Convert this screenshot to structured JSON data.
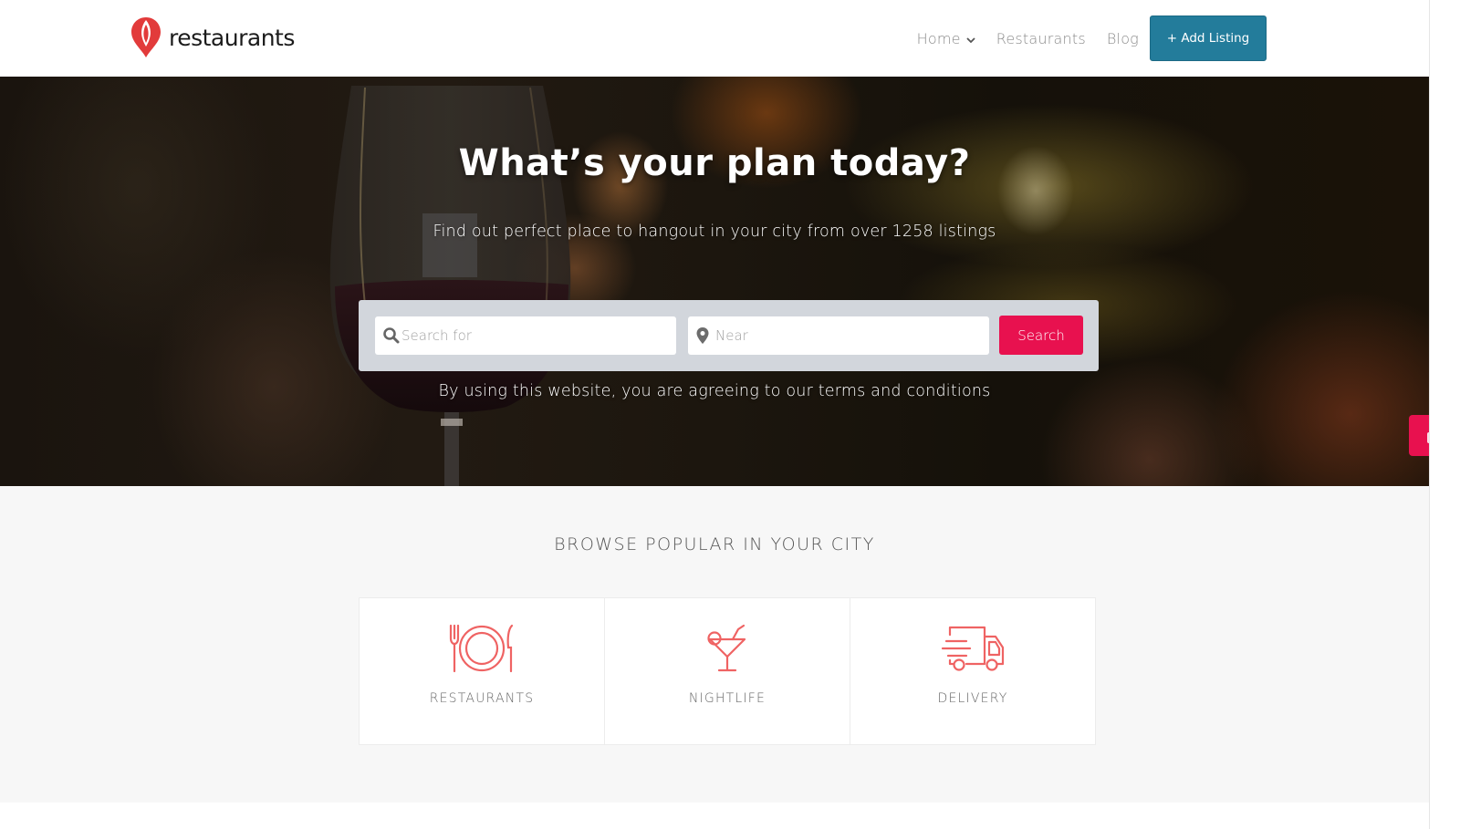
{
  "header": {
    "logo_text": "restaurants",
    "nav": [
      {
        "label": "Home",
        "has_dropdown": true
      },
      {
        "label": "Restaurants",
        "has_dropdown": false
      },
      {
        "label": "Blog",
        "has_dropdown": false
      }
    ],
    "add_listing_label": "+ Add Listing"
  },
  "hero": {
    "title": "What’s your plan today?",
    "subtitle": "Find out perfect place to hangout in your city from over 1258 listings",
    "search": {
      "query_placeholder": "Search for",
      "query_value": "",
      "near_placeholder": "Near",
      "near_value": "",
      "button_label": "Search"
    },
    "terms_text": "By using this website, you are agreeing to our terms and conditions"
  },
  "browse": {
    "title": "BROWSE POPULAR IN YOUR CITY",
    "categories": [
      {
        "label": "RESTAURANTS",
        "icon": "plate-cutlery-icon"
      },
      {
        "label": "NIGHTLIFE",
        "icon": "cocktail-icon"
      },
      {
        "label": "DELIVERY",
        "icon": "delivery-truck-icon"
      }
    ]
  },
  "colors": {
    "brand_red": "#e8114f",
    "add_listing_blue": "#237c9b",
    "icon_coral": "#ef6363",
    "logo_red": "#e23b3b"
  }
}
